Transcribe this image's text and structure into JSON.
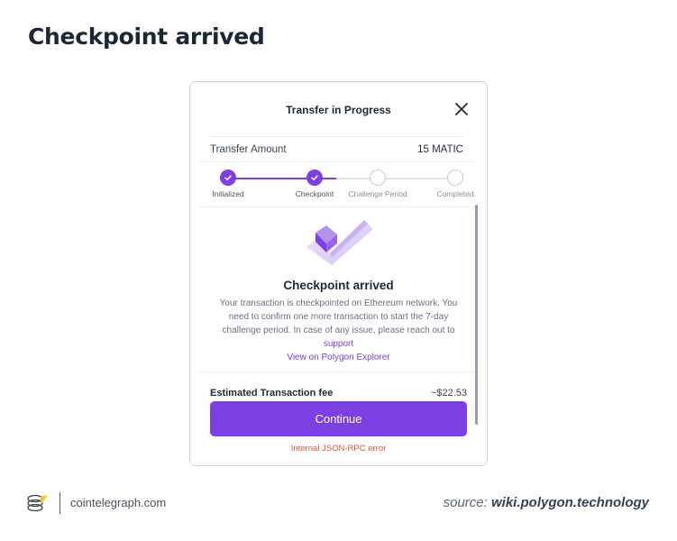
{
  "page": {
    "title": "Checkpoint arrived"
  },
  "modal": {
    "title": "Transfer in Progress",
    "amount_label": "Transfer Amount",
    "amount_value": "15 MATIC",
    "steps": [
      {
        "label": "Initialized",
        "state": "done"
      },
      {
        "label": "Checkpoint",
        "state": "done"
      },
      {
        "label": "Challenge Period",
        "state": "todo"
      },
      {
        "label": "Completed",
        "state": "todo"
      }
    ],
    "status_title": "Checkpoint arrived",
    "status_description": "Your transaction is checkpointed on Ethereum network. You need to confirm one more transaction to start the 7-day challenge period. In case of any issue, please reach out to",
    "support_link": "support",
    "explorer_link": "View on Polygon Explorer",
    "fee_label": "Estimated Transaction fee",
    "fee_value": "~$22.53",
    "continue_label": "Continue",
    "error_text": "Internal JSON-RPC error"
  },
  "footer": {
    "brand": "cointelegraph.com",
    "source_prefix": "source:",
    "source_site": "wiki.polygon.technology"
  },
  "colors": {
    "accent": "#7b3fe4",
    "error": "#e2533f",
    "title": "#1c2733"
  },
  "icons": {
    "close": "close-icon",
    "check": "check-icon",
    "illustration": "checkpoint-illustration",
    "logo": "cointelegraph-logo"
  }
}
